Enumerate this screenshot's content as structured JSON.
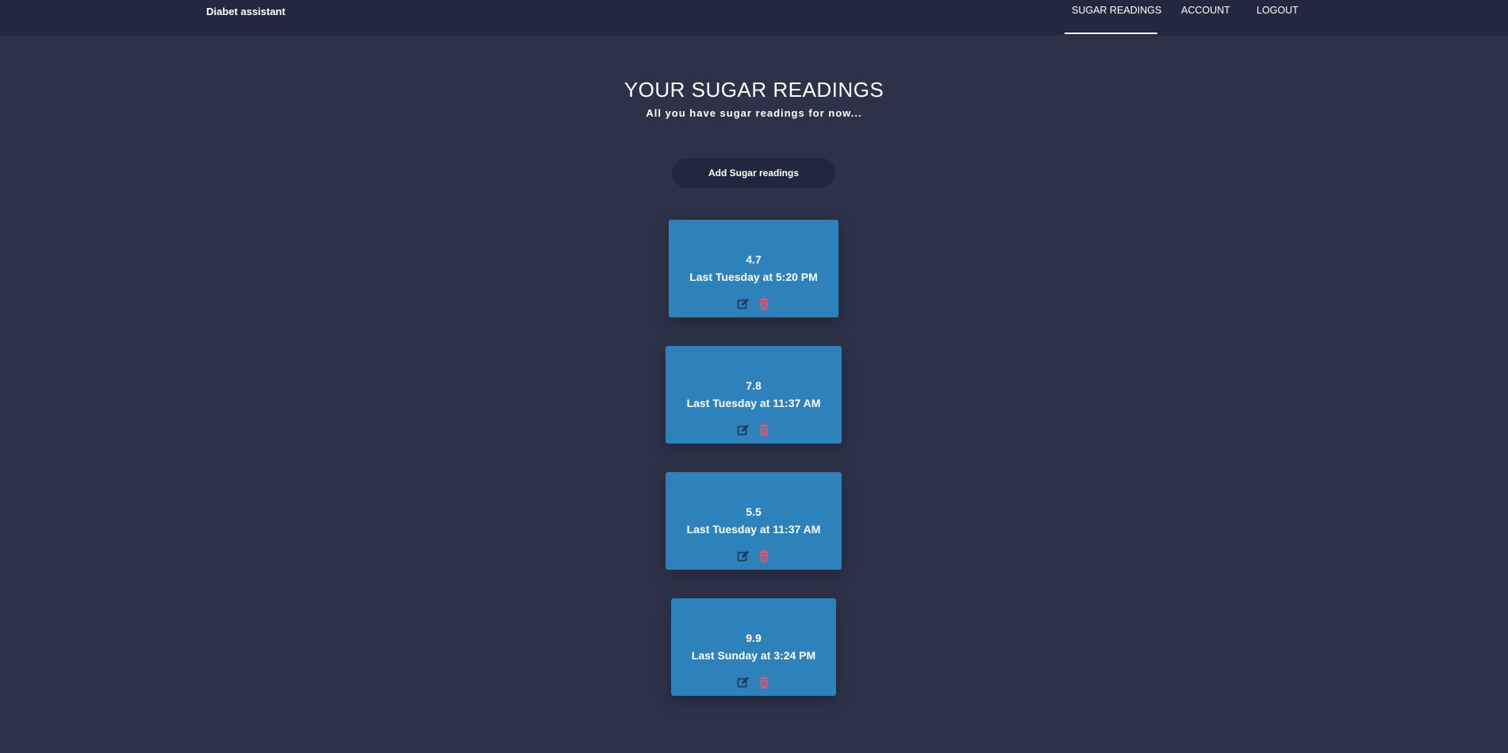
{
  "header": {
    "brand": "Diabet assistant",
    "nav": [
      {
        "label": "SUGAR READINGS",
        "active": true
      },
      {
        "label": "ACCOUNT",
        "active": false
      },
      {
        "label": "LOGOUT",
        "active": false
      }
    ]
  },
  "main": {
    "title": "YOUR SUGAR READINGS",
    "subtitle": "All you have sugar readings for now...",
    "add_button_label": "Add Sugar readings"
  },
  "readings": [
    {
      "value": "4.7",
      "time": "Last Tuesday at 5:20 PM"
    },
    {
      "value": "7.8",
      "time": "Last Tuesday at 11:37 AM"
    },
    {
      "value": "5.5",
      "time": "Last Tuesday at 11:37 AM"
    },
    {
      "value": "9.9",
      "time": "Last Sunday at 3:24 PM"
    }
  ],
  "icons": {
    "edit": "edit-icon",
    "delete": "trash-icon"
  },
  "colors": {
    "background": "#2d3249",
    "header": "#232840",
    "card": "#2e82bb",
    "edit_icon": "#1e3a5c",
    "delete_icon": "#e0566b"
  }
}
